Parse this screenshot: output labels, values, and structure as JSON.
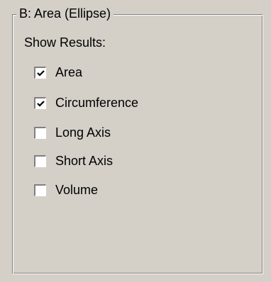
{
  "group": {
    "title": "B: Area (Ellipse)",
    "show_results_label": "Show Results:"
  },
  "checkboxes": [
    {
      "label": "Area",
      "checked": true
    },
    {
      "label": "Circumference",
      "checked": true
    },
    {
      "label": "Long Axis",
      "checked": false
    },
    {
      "label": "Short Axis",
      "checked": false
    },
    {
      "label": "Volume",
      "checked": false
    }
  ]
}
